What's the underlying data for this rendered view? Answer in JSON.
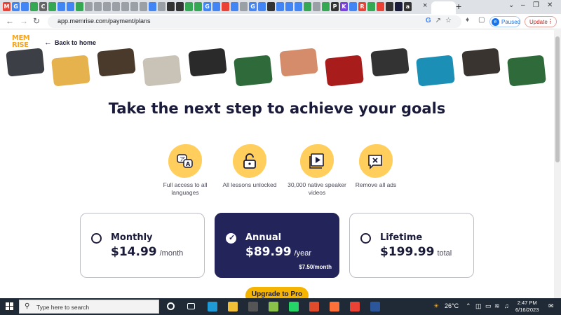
{
  "browser": {
    "tabs": [
      {
        "letter": "M",
        "color": "#ea4335"
      },
      {
        "letter": "G",
        "color": "#4285f4"
      },
      {
        "letter": "",
        "color": "#4285f4"
      },
      {
        "letter": "",
        "color": "#34a853"
      },
      {
        "letter": "C",
        "color": "#666666"
      },
      {
        "letter": "",
        "color": "#34a853"
      },
      {
        "letter": "",
        "color": "#4285f4"
      },
      {
        "letter": "",
        "color": "#4285f4"
      },
      {
        "letter": "",
        "color": "#34a853"
      },
      {
        "letter": "",
        "color": "#9aa0a6"
      },
      {
        "letter": "",
        "color": "#9aa0a6"
      },
      {
        "letter": "",
        "color": "#9aa0a6"
      },
      {
        "letter": "",
        "color": "#9aa0a6"
      },
      {
        "letter": "",
        "color": "#9aa0a6"
      },
      {
        "letter": "",
        "color": "#9aa0a6"
      },
      {
        "letter": "",
        "color": "#9aa0a6"
      },
      {
        "letter": "",
        "color": "#4285f4"
      },
      {
        "letter": "",
        "color": "#9aa0a6"
      },
      {
        "letter": "",
        "color": "#333333"
      },
      {
        "letter": "",
        "color": "#333333"
      },
      {
        "letter": "",
        "color": "#34a853"
      },
      {
        "letter": "",
        "color": "#34a853"
      },
      {
        "letter": "G",
        "color": "#4285f4"
      },
      {
        "letter": "",
        "color": "#4285f4"
      },
      {
        "letter": "",
        "color": "#ea4335"
      },
      {
        "letter": "",
        "color": "#4285f4"
      },
      {
        "letter": "",
        "color": "#9aa0a6"
      },
      {
        "letter": "G",
        "color": "#4285f4"
      },
      {
        "letter": "",
        "color": "#4285f4"
      },
      {
        "letter": "",
        "color": "#333333"
      },
      {
        "letter": "",
        "color": "#4285f4"
      },
      {
        "letter": "",
        "color": "#4285f4"
      },
      {
        "letter": "",
        "color": "#4285f4"
      },
      {
        "letter": "",
        "color": "#34a853"
      },
      {
        "letter": "",
        "color": "#9aa0a6"
      },
      {
        "letter": "",
        "color": "#34a853"
      },
      {
        "letter": "P",
        "color": "#333333"
      },
      {
        "letter": "K",
        "color": "#7b3fe4"
      },
      {
        "letter": "",
        "color": "#4285f4"
      },
      {
        "letter": "R",
        "color": "#ea4335"
      },
      {
        "letter": "",
        "color": "#34a853"
      },
      {
        "letter": "",
        "color": "#ea4335"
      },
      {
        "letter": "",
        "color": "#333333"
      },
      {
        "letter": "",
        "color": "#1a1a3a"
      },
      {
        "letter": "a",
        "color": "#333333"
      }
    ],
    "close_glyph": "×",
    "new_tab_glyph": "+",
    "url": "app.memrise.com/payment/plans",
    "profile_initial": "e",
    "paused_label": "Paused",
    "update_label": "Update"
  },
  "header": {
    "logo": "MEM RISE",
    "back_label": "Back to home"
  },
  "strip_tiles": [
    {
      "color": "#3c3f45"
    },
    {
      "color": "#e6b24d"
    },
    {
      "color": "#4a3a2c"
    },
    {
      "color": "#c9c2b7"
    },
    {
      "color": "#2a2a2a"
    },
    {
      "color": "#2f6b3a"
    },
    {
      "color": "#d48c6a"
    },
    {
      "color": "#a81c1c"
    },
    {
      "color": "#333333"
    },
    {
      "color": "#1b8fb5"
    },
    {
      "color": "#3a3431"
    },
    {
      "color": "#2f6b3a"
    }
  ],
  "headline": "Take the next step to achieve your goals",
  "features": [
    {
      "icon": "translate-icon",
      "label": "Full access to all languages"
    },
    {
      "icon": "unlock-icon",
      "label": "All lessons unlocked"
    },
    {
      "icon": "video-icon",
      "label": "30,000 native speaker videos"
    },
    {
      "icon": "no-ads-icon",
      "label": "Remove all ads"
    }
  ],
  "plans": [
    {
      "name": "Monthly",
      "price": "$14.99",
      "period": "/month",
      "note": "",
      "selected": false
    },
    {
      "name": "Annual",
      "price": "$89.99",
      "period": "/year",
      "note": "$7.50/month",
      "selected": true
    },
    {
      "name": "Lifetime",
      "price": "$199.99",
      "period": "total",
      "note": "",
      "selected": false
    }
  ],
  "cta_label": "Upgrade to Pro",
  "taskbar": {
    "search_placeholder": "Type here to search",
    "weather": "26°C",
    "time": "2:47 PM",
    "date": "6/16/2023",
    "apps": [
      {
        "name": "cortana",
        "color": "#ffffff"
      },
      {
        "name": "task-view",
        "color": "#ffffff"
      },
      {
        "name": "edge",
        "color": "#1f9ad6"
      },
      {
        "name": "file-explorer",
        "color": "#f2c037"
      },
      {
        "name": "store",
        "color": "#555555"
      },
      {
        "name": "app",
        "color": "#8bc34a"
      },
      {
        "name": "whatsapp",
        "color": "#25d366"
      },
      {
        "name": "mail",
        "color": "#e04b2b"
      },
      {
        "name": "firefox",
        "color": "#ff7139"
      },
      {
        "name": "chrome",
        "color": "#ea4335"
      },
      {
        "name": "word",
        "color": "#2b579a"
      }
    ]
  }
}
